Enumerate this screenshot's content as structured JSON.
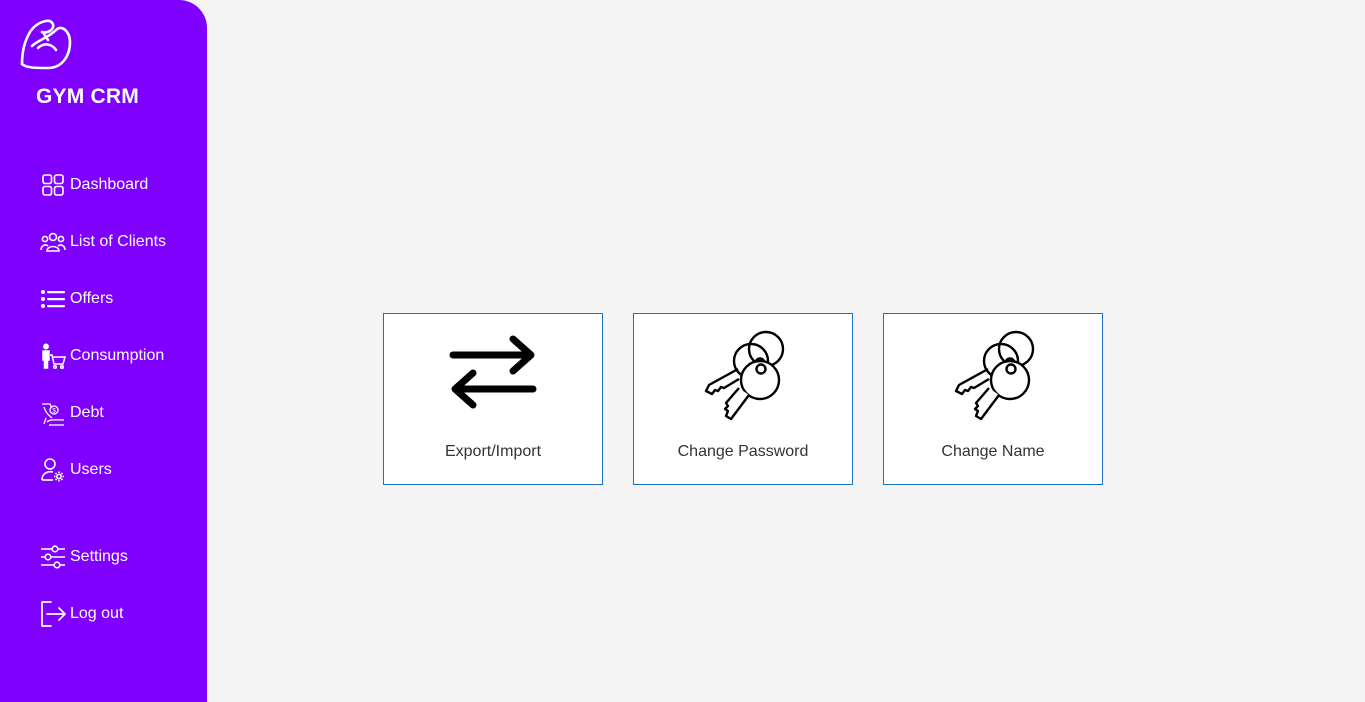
{
  "app": {
    "title": "GYM CRM",
    "logo_icon": "flexed-arm-icon"
  },
  "colors": {
    "sidebar": "#7f00ff",
    "background": "#f4f4f4",
    "card_border": "#1a73c4",
    "card_text": "#333333"
  },
  "sidebar": {
    "items": [
      {
        "label": "Dashboard",
        "icon": "grid-icon"
      },
      {
        "label": "List of Clients",
        "icon": "users-group-icon"
      },
      {
        "label": "Offers",
        "icon": "list-icon"
      },
      {
        "label": "Consumption",
        "icon": "person-cart-icon"
      },
      {
        "label": "Debt",
        "icon": "hand-money-icon"
      },
      {
        "label": "Users",
        "icon": "user-gear-icon"
      }
    ],
    "bottom_items": [
      {
        "label": "Settings",
        "icon": "sliders-icon"
      },
      {
        "label": "Log out",
        "icon": "logout-icon"
      }
    ]
  },
  "main": {
    "cards": [
      {
        "label": "Export/Import",
        "icon": "swap-arrows-icon"
      },
      {
        "label": "Change Password",
        "icon": "keys-icon"
      },
      {
        "label": "Change Name",
        "icon": "keys-icon"
      }
    ]
  }
}
